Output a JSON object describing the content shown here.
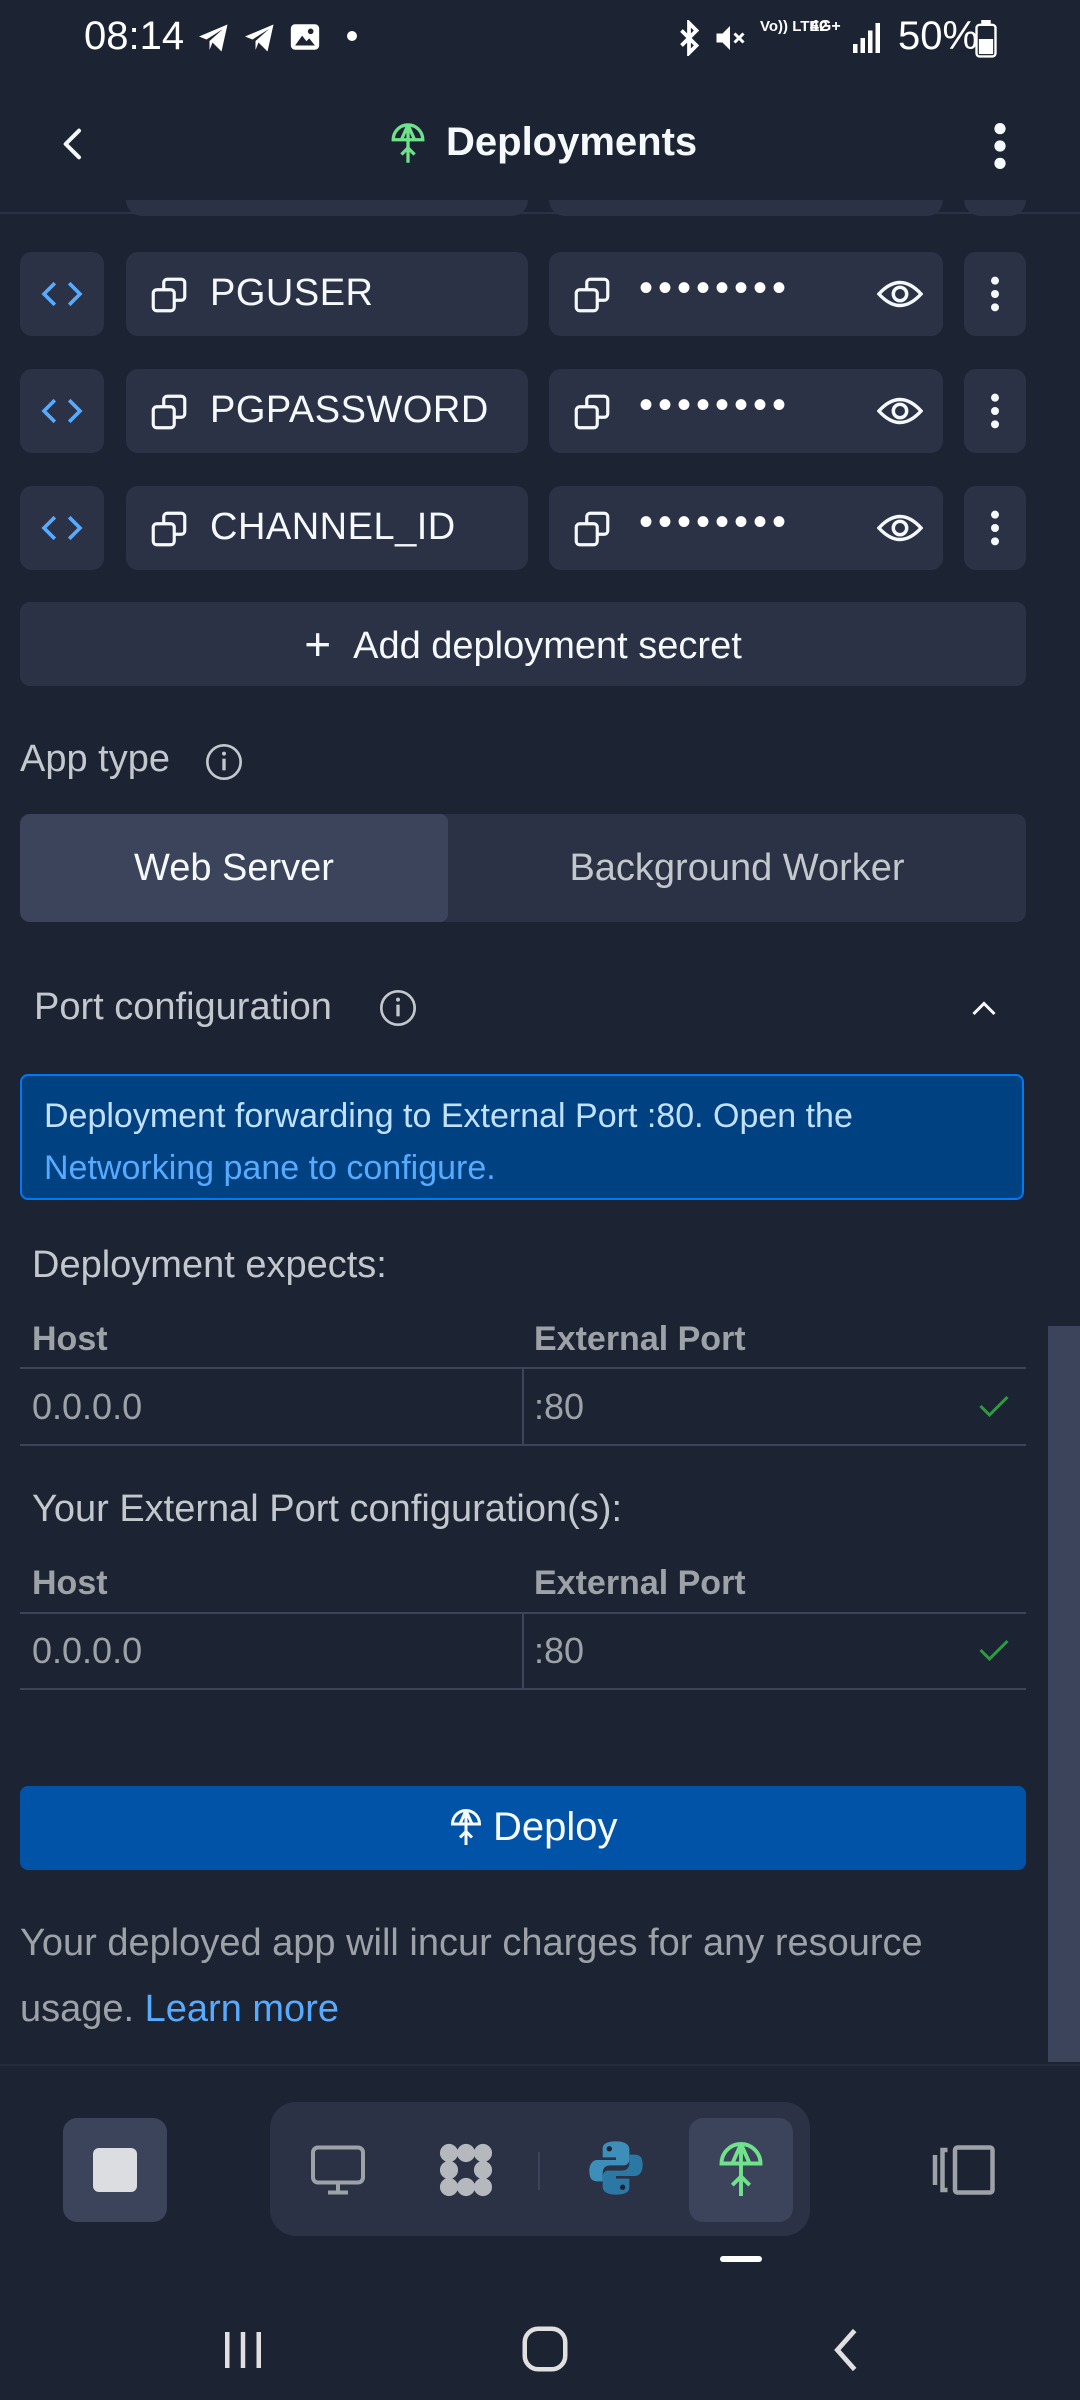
{
  "status_bar": {
    "time": "08:14",
    "battery": "50%",
    "network_labels": [
      "Vo)) LTE2",
      "4G+"
    ]
  },
  "header": {
    "title": "Deployments",
    "back_icon": "chevron-left-icon",
    "menu_icon": "kebab-menu-icon"
  },
  "secrets": [
    {
      "key": "PGUSER",
      "value_masked": "••••••••"
    },
    {
      "key": "PGPASSWORD",
      "value_masked": "••••••••"
    },
    {
      "key": "CHANNEL_ID",
      "value_masked": "••••••••"
    }
  ],
  "add_secret_label": "Add deployment secret",
  "app_type": {
    "label": "App type",
    "options": [
      "Web Server",
      "Background Worker"
    ],
    "selected": "Web Server"
  },
  "port_config": {
    "title": "Port configuration",
    "banner_text": "Deployment forwarding to External Port :80. Open the",
    "banner_link": "Networking pane to configure.",
    "expects_label": "Deployment expects:",
    "your_label": "Your External Port configuration(s):",
    "columns": [
      "Host",
      "External Port"
    ],
    "expects_rows": [
      {
        "host": "0.0.0.0",
        "port": ":80"
      }
    ],
    "your_rows": [
      {
        "host": "0.0.0.0",
        "port": ":80"
      }
    ]
  },
  "deploy_label": "Deploy",
  "footer": {
    "text": "Your deployed app will incur charges for any resource usage.",
    "link": "Learn more"
  },
  "colors": {
    "background": "#1c2333",
    "surface": "#2b3245",
    "primary": "#0053a6",
    "link": "#57abff",
    "success": "#2e9b3f",
    "deploy_icon": "#6fe28b"
  }
}
